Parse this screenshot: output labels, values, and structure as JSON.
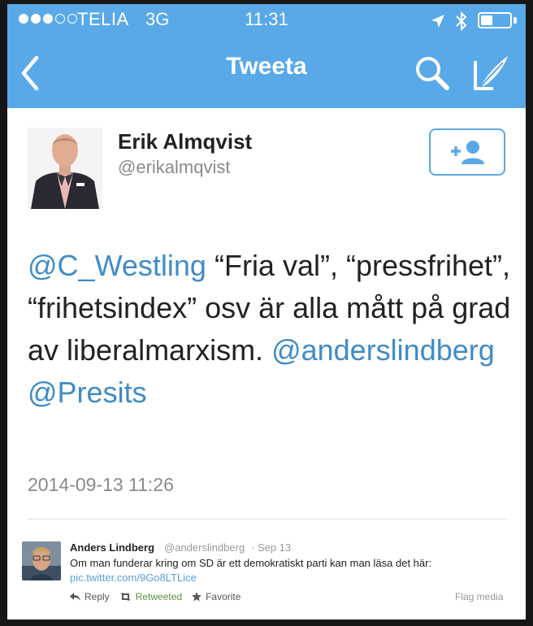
{
  "status_bar": {
    "carrier": "TELIA",
    "network": "3G",
    "time": "11:31",
    "signal_bars_filled": 3,
    "signal_bars_total": 5,
    "battery_level": 0.4
  },
  "nav": {
    "title": "Tweeta",
    "back_icon": "chevron-left-icon",
    "search_icon": "search-icon",
    "compose_icon": "compose-icon"
  },
  "tweet": {
    "author_name": "Erik Almqvist",
    "author_handle": "@erikalmqvist",
    "follow_icon": "add-user-icon",
    "parts": {
      "m1": "@C_Westling",
      "t1": " “Fria val”, “pressfrihet”, “frihetsindex” osv är alla mått på grad av liberalmarxism. ",
      "m2": "@anderslindberg",
      "m3": "@Presits"
    },
    "timestamp": "2014-09-13 11:26"
  },
  "embedded": {
    "name": "Anders Lindberg",
    "handle": "@anderslindberg",
    "date": "· Sep 13",
    "text": "Om man funderar kring om SD är ett demokratiskt parti kan man läsa det här:",
    "link": "pic.twitter.com/9Go8LTLice",
    "actions": {
      "reply": "Reply",
      "retweeted": "Retweeted",
      "favorite": "Favorite",
      "flag": "Flag media"
    }
  },
  "colors": {
    "header": "#59a9e8",
    "mention": "#3f8cc5",
    "retweeted": "#5c913b"
  }
}
